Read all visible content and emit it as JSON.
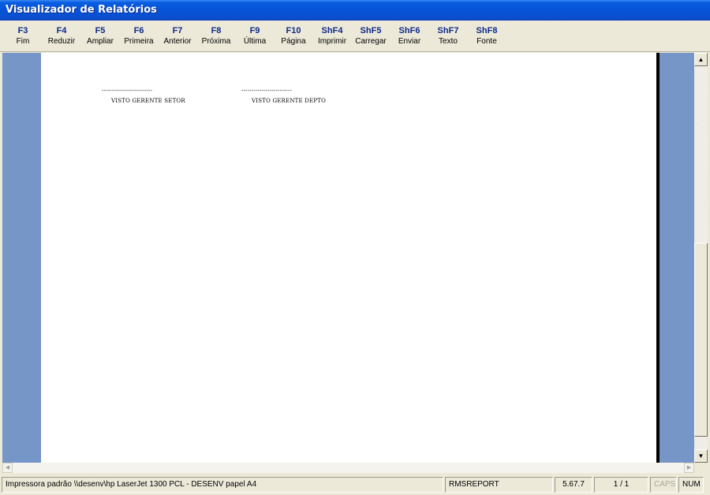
{
  "window": {
    "title": "Visualizador de Relatórios"
  },
  "toolbar": {
    "buttons": [
      {
        "key": "F3",
        "label": "Fim"
      },
      {
        "key": "F4",
        "label": "Reduzir"
      },
      {
        "key": "F5",
        "label": "Ampliar"
      },
      {
        "key": "F6",
        "label": "Primeira"
      },
      {
        "key": "F7",
        "label": "Anterior"
      },
      {
        "key": "F8",
        "label": "Próxima"
      },
      {
        "key": "F9",
        "label": "Última"
      },
      {
        "key": "F10",
        "label": "Página"
      },
      {
        "key": "ShF4",
        "label": "Imprimir"
      },
      {
        "key": "ShF5",
        "label": "Carregar"
      },
      {
        "key": "ShF6",
        "label": "Enviar"
      },
      {
        "key": "ShF7",
        "label": "Texto"
      },
      {
        "key": "ShF8",
        "label": "Fonte"
      }
    ]
  },
  "report": {
    "signature_lines": [
      {
        "line": "-------------------------",
        "label": "VISTO GERENTE SETOR"
      },
      {
        "line": "-------------------------",
        "label": "VISTO GERENTE DEPTO"
      }
    ]
  },
  "statusbar": {
    "printer": "Impressora padrão \\\\desenv\\hp LaserJet 1300 PCL - DESENV papel A4",
    "module": "RMSREPORT",
    "version": "5.67.7",
    "pages": "1 / 1",
    "caps": "CAPS",
    "num": "NUM"
  },
  "colors": {
    "titlebar": "#0653d8",
    "viewer_background": "#7596c6",
    "key_text": "#0f2a8a"
  },
  "icons": {
    "scroll_up": "▲",
    "scroll_down": "▼",
    "scroll_left": "◀",
    "scroll_right": "▶"
  }
}
